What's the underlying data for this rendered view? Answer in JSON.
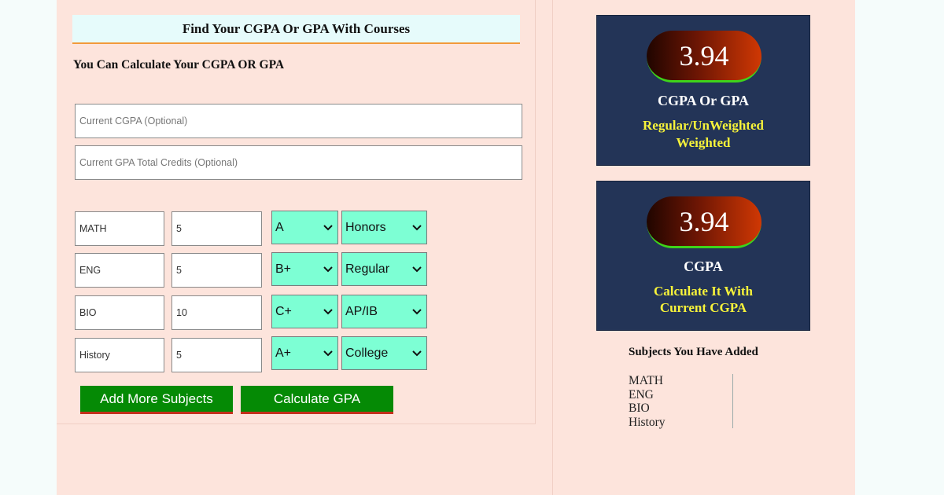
{
  "form": {
    "title": "Find Your CGPA Or GPA With Courses",
    "subtitle": "You Can Calculate Your CGPA OR GPA",
    "current_cgpa_placeholder": "Current CGPA (Optional)",
    "current_credits_placeholder": "Current GPA Total Credits (Optional)",
    "rows": [
      {
        "subject": "MATH",
        "credits": "5",
        "grade": "A",
        "type": "Honors"
      },
      {
        "subject": "ENG",
        "credits": "5",
        "grade": "B+",
        "type": "Regular"
      },
      {
        "subject": "BIO",
        "credits": "10",
        "grade": "C+",
        "type": "AP/IB"
      },
      {
        "subject": "History",
        "credits": "5",
        "grade": "A+",
        "type": "College"
      }
    ],
    "add_button": "Add More Subjects",
    "calc_button": "Calculate GPA"
  },
  "result_cards": [
    {
      "value": "3.94",
      "heading": "CGPA Or GPA",
      "sub_line1": "Regular/UnWeighted",
      "sub_line2": "Weighted"
    },
    {
      "value": "3.94",
      "heading": "CGPA",
      "sub_line1": "Calculate It With",
      "sub_line2": "Current CGPA"
    }
  ],
  "added": {
    "heading": "Subjects You Have Added",
    "items": [
      "MATH",
      "ENG",
      "BIO",
      "History"
    ]
  },
  "colors": {
    "page_bg": "#fde4dc",
    "select_bg": "#7dffd4",
    "button_green": "#058a05",
    "card_navy": "#233457",
    "card_yellow": "#f7f33a"
  }
}
